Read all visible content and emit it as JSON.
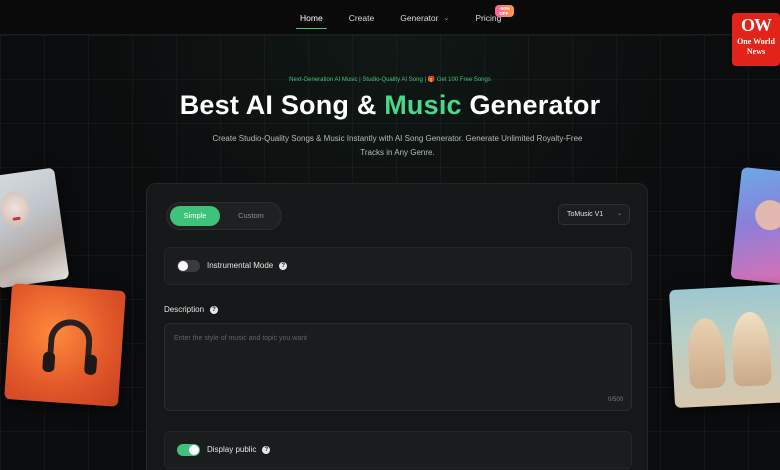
{
  "nav": {
    "items": [
      {
        "label": "Home",
        "active": true
      },
      {
        "label": "Create",
        "active": false
      },
      {
        "label": "Generator",
        "active": false,
        "has_dropdown": true
      },
      {
        "label": "Pricing",
        "active": false,
        "badge": "-50% OFF"
      }
    ]
  },
  "watermark": {
    "icon": "ow-logo",
    "lines": [
      "One World",
      "News"
    ]
  },
  "hero": {
    "tagline": "Next-Generation AI Music | Studio-Quality AI Song | 🎁 Get 100 Free Songs",
    "headline_pre": "Best AI Song & ",
    "headline_accent": "Music",
    "headline_post": " Generator",
    "subtitle": "Create Studio-Quality Songs & Music Instantly with AI Song Generator. Generate Unlimited Royalty-Free Tracks in Any Genre."
  },
  "form": {
    "mode_simple": "Simple",
    "mode_custom": "Custom",
    "mode_selected": "Simple",
    "model": "ToMusic V1",
    "instrumental_label": "Instrumental Mode",
    "instrumental_on": false,
    "description_label": "Description",
    "description_placeholder": "Enter the style of music and topic you want",
    "description_counter": "0/500",
    "public_label": "Display public",
    "public_on": true
  },
  "colors": {
    "accent": "#3fc27a",
    "background": "#0b0c0d",
    "panel": "#161718",
    "watermark": "#e2231a"
  }
}
